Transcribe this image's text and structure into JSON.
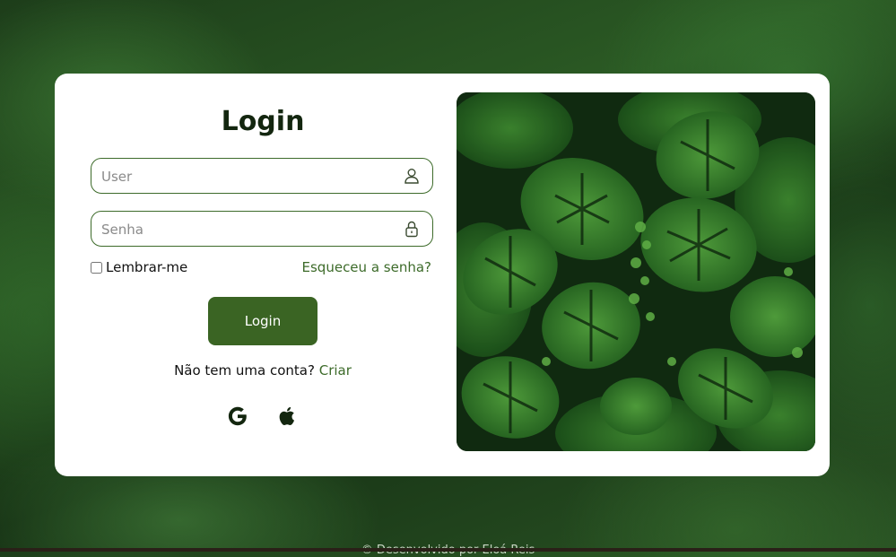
{
  "login": {
    "title": "Login",
    "user_placeholder": "User",
    "password_placeholder": "Senha",
    "remember_label": "Lembrar-me",
    "forgot_label": "Esqueceu a senha?",
    "submit_label": "Login",
    "signup_prompt": "Não tem uma conta?",
    "signup_link": "Criar"
  },
  "social": {
    "google_icon": "google-icon",
    "apple_icon": "apple-icon"
  },
  "colors": {
    "accent": "#3a6423",
    "link": "#3d6b2a",
    "title": "#13260f"
  },
  "footer": {
    "text": "© Desenvolvido por Eloá Reis"
  }
}
